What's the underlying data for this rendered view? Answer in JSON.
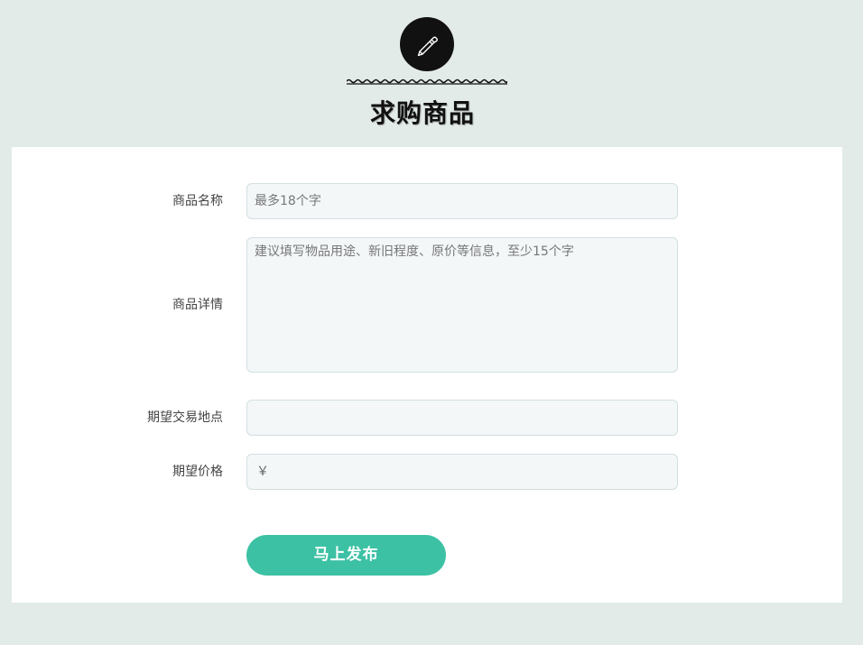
{
  "header": {
    "icon": "pencil-icon",
    "title": "求购商品"
  },
  "form": {
    "name": {
      "label": "商品名称",
      "placeholder": "最多18个字"
    },
    "details": {
      "label": "商品详情",
      "placeholder": "建议填写物品用途、新旧程度、原价等信息，至少15个字"
    },
    "location": {
      "label": "期望交易地点",
      "placeholder": ""
    },
    "price": {
      "label": "期望价格",
      "prefix": "￥"
    },
    "submit_label": "马上发布"
  },
  "colors": {
    "background": "#e3ebe9",
    "panel": "#ffffff",
    "field_bg": "#f3f7f8",
    "accent": "#3dc1a4"
  }
}
